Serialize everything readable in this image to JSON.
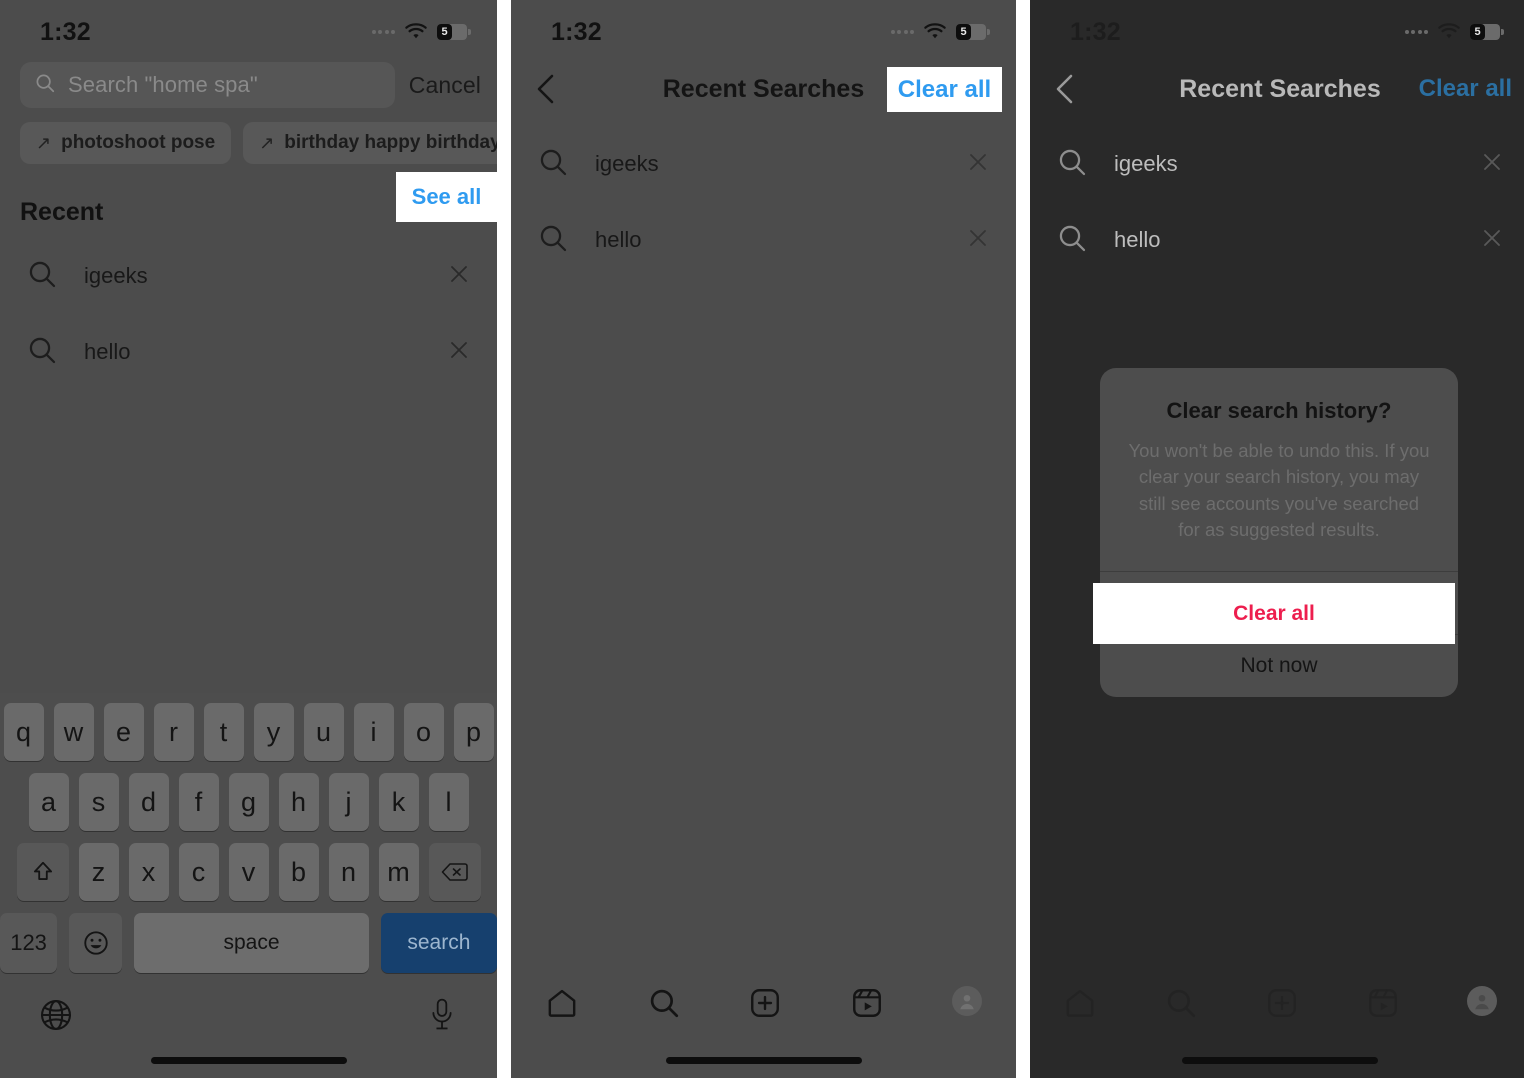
{
  "meta": {
    "app": "Instagram",
    "flow": "Clear Instagram search history on iPhone",
    "panel_count": 3
  },
  "status_bar": {
    "time": "1:32",
    "battery_level_text": "5",
    "icons": [
      "signal-dots-icon",
      "wifi-icon",
      "battery-icon"
    ]
  },
  "panel1": {
    "search": {
      "placeholder": "Search \"home spa\"",
      "value": "",
      "icon": "search-icon",
      "cancel_label": "Cancel"
    },
    "chips": [
      {
        "label": "photoshoot pose",
        "icon": "arrow-up-right-icon"
      },
      {
        "label": "birthday happy birthday reels",
        "icon": "arrow-up-right-icon"
      }
    ],
    "recent": {
      "title": "Recent",
      "see_all_label": "See all",
      "items": [
        {
          "text": "igeeks",
          "icon": "search-icon",
          "remove_icon": "close-icon"
        },
        {
          "text": "hello",
          "icon": "search-icon",
          "remove_icon": "close-icon"
        }
      ]
    },
    "keyboard": {
      "row1": [
        "q",
        "w",
        "e",
        "r",
        "t",
        "y",
        "u",
        "i",
        "o",
        "p"
      ],
      "row2": [
        "a",
        "s",
        "d",
        "f",
        "g",
        "h",
        "j",
        "k",
        "l"
      ],
      "row3": [
        "z",
        "x",
        "c",
        "v",
        "b",
        "n",
        "m"
      ],
      "shift_icon": "shift-icon",
      "backspace_icon": "backspace-icon",
      "numbers_label": "123",
      "emoji_icon": "emoji-icon",
      "space_label": "space",
      "return_label": "search",
      "globe_icon": "globe-icon",
      "mic_icon": "microphone-icon"
    }
  },
  "panel2": {
    "nav": {
      "back_icon": "chevron-left-icon",
      "title": "Recent Searches",
      "action_label": "Clear all"
    },
    "items": [
      {
        "text": "igeeks",
        "icon": "search-icon",
        "remove_icon": "close-icon"
      },
      {
        "text": "hello",
        "icon": "search-icon",
        "remove_icon": "close-icon"
      }
    ],
    "tabs": [
      {
        "name": "home-tab",
        "icon": "home-icon"
      },
      {
        "name": "search-tab",
        "icon": "search-icon"
      },
      {
        "name": "create-tab",
        "icon": "plus-square-icon"
      },
      {
        "name": "reels-tab",
        "icon": "reels-icon"
      },
      {
        "name": "profile-tab",
        "icon": "avatar-icon"
      }
    ]
  },
  "panel3": {
    "nav": {
      "back_icon": "chevron-left-icon",
      "title": "Recent Searches",
      "action_label": "Clear all"
    },
    "items": [
      {
        "text": "igeeks",
        "icon": "search-icon",
        "remove_icon": "close-icon"
      },
      {
        "text": "hello",
        "icon": "search-icon",
        "remove_icon": "close-icon"
      }
    ],
    "dialog": {
      "title": "Clear search history?",
      "message": "You won't be able to undo this. If you clear your search history, you may still see accounts you've searched for as suggested results.",
      "confirm_label": "Clear all",
      "dismiss_label": "Not now"
    },
    "tabs": [
      {
        "name": "home-tab",
        "icon": "home-icon"
      },
      {
        "name": "search-tab",
        "icon": "search-icon"
      },
      {
        "name": "create-tab",
        "icon": "plus-square-icon"
      },
      {
        "name": "reels-tab",
        "icon": "reels-icon"
      },
      {
        "name": "profile-tab",
        "icon": "avatar-icon"
      }
    ]
  },
  "colors": {
    "panel_bg": "#4c4c4c",
    "panel_dim_bg": "#292929",
    "accent_blue": "#2f9bf0",
    "destructive_red": "#ed1e4e",
    "highlight_bg": "#ffffff",
    "keyboard_bg": "#4d4d4d",
    "return_key_bg": "#16406e"
  }
}
